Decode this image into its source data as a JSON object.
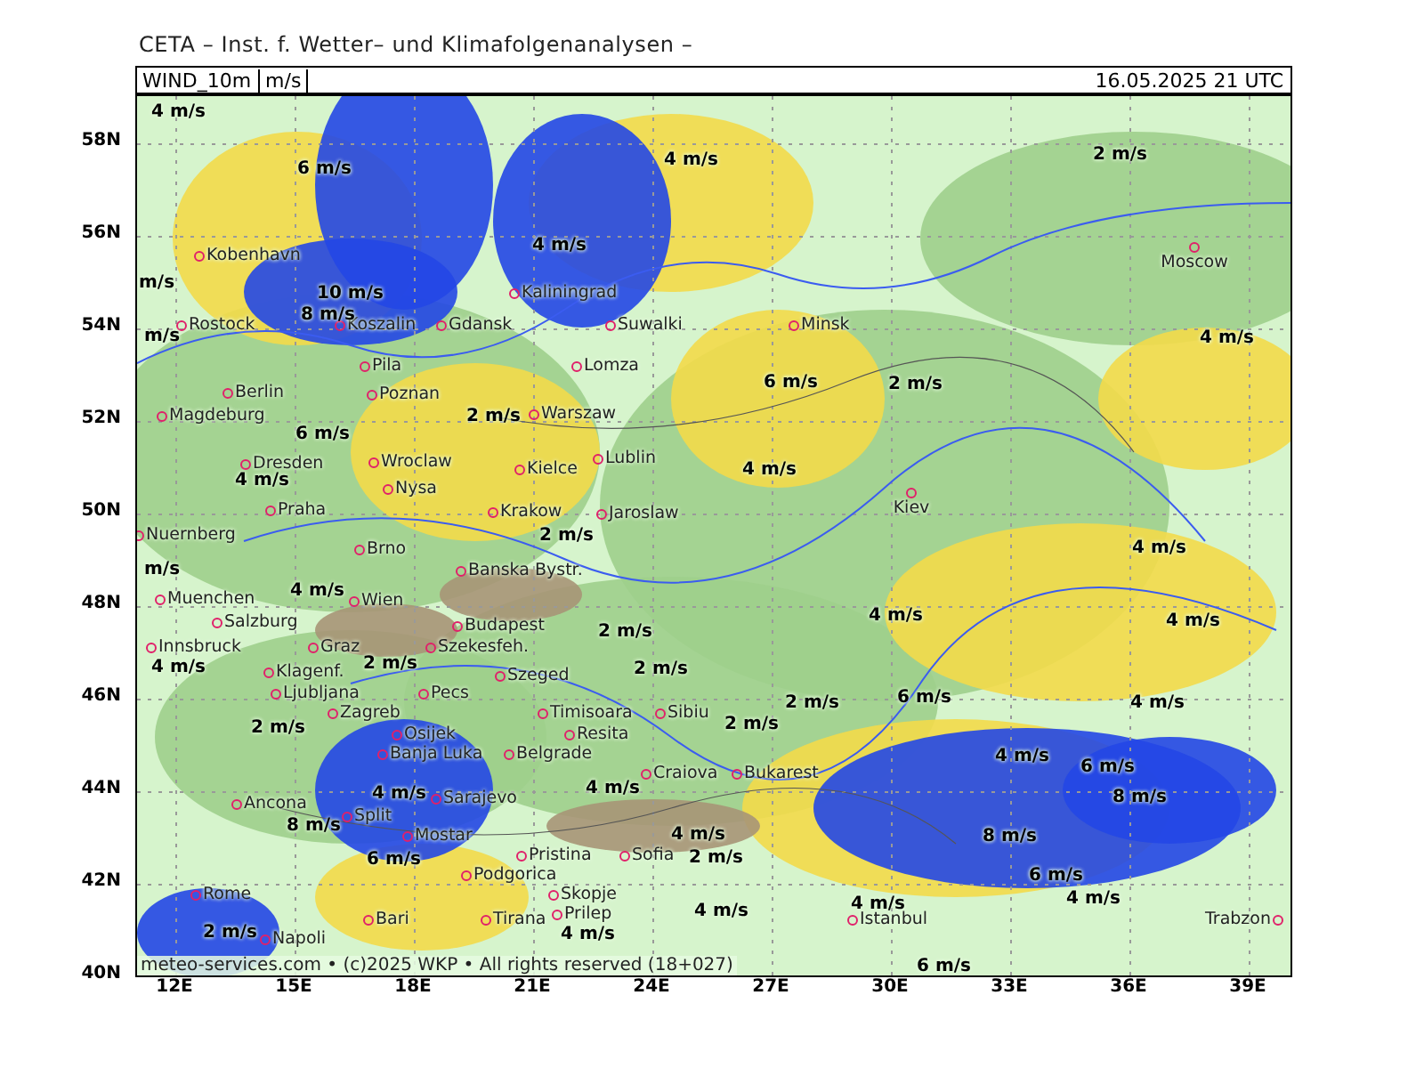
{
  "header": "CETA – Inst. f. Wetter– und Klimafolgenanalysen –",
  "title_bar": {
    "field": "WIND_10m",
    "unit": "m/s",
    "datetime": "16.05.2025 21 UTC"
  },
  "map": {
    "wind_labels": [
      "4 m/s",
      "6 m/s",
      "4 m/s",
      "2 m/s",
      "4 m/s",
      "m/s",
      "10 m/s",
      "8 m/s",
      "m/s",
      "4 m/s",
      "6 m/s",
      "2 m/s",
      "2 m/s",
      "6 m/s",
      "4 m/s",
      "4 m/s",
      "2 m/s",
      "4 m/s",
      "m/s",
      "4 m/s",
      "2 m/s",
      "4 m/s",
      "4 m/s",
      "4 m/s",
      "2 m/s",
      "2 m/s",
      "2 m/s",
      "6 m/s",
      "4 m/s",
      "2 m/s",
      "2 m/s",
      "4 m/s",
      "6 m/s",
      "4 m/s",
      "4 m/s",
      "8 m/s",
      "8 m/s",
      "4 m/s",
      "8 m/s",
      "6 m/s",
      "2 m/s",
      "6 m/s",
      "4 m/s",
      "4 m/s",
      "4 m/s",
      "2 m/s",
      "4 m/s",
      "6 m/s"
    ],
    "cities": [
      "Kobenhavn",
      "Moscow",
      "Kaliningrad",
      "Rostock",
      "Koszalin",
      "Gdansk",
      "Suwalki",
      "Minsk",
      "Pila",
      "Lomza",
      "Berlin",
      "Poznan",
      "Magdeburg",
      "Warszaw",
      "Dresden",
      "Wroclaw",
      "Kielce",
      "Lublin",
      "Nysa",
      "Praha",
      "Krakow",
      "Jaroslaw",
      "Kiev",
      "Nuernberg",
      "Brno",
      "Banska Bystr.",
      "Muenchen",
      "Wien",
      "Salzburg",
      "Budapest",
      "Innsbruck",
      "Graz",
      "Szekesfeh.",
      "Klagenf.",
      "Szeged",
      "Ljubljana",
      "Pecs",
      "Zagreb",
      "Timisoara",
      "Sibiu",
      "Osijek",
      "Resita",
      "Banja Luka",
      "Belgrade",
      "Craiova",
      "Bukarest",
      "Ancona",
      "Split",
      "Sarajevo",
      "Mostar",
      "Pristina",
      "Sofia",
      "Podgorica",
      "Rome",
      "Skopje",
      "Bari",
      "Tirana",
      "Prilep",
      "Istanbul",
      "Trabzon",
      "Napoli"
    ],
    "copyright": "meteo-services.com • (c)2025 WKP • All rights reserved (18+027)"
  },
  "lat_labels": [
    "58N",
    "56N",
    "54N",
    "52N",
    "50N",
    "48N",
    "46N",
    "44N",
    "42N",
    "40N"
  ],
  "lon_labels": [
    "12E",
    "15E",
    "18E",
    "21E",
    "24E",
    "27E",
    "30E",
    "33E",
    "36E",
    "39E"
  ]
}
